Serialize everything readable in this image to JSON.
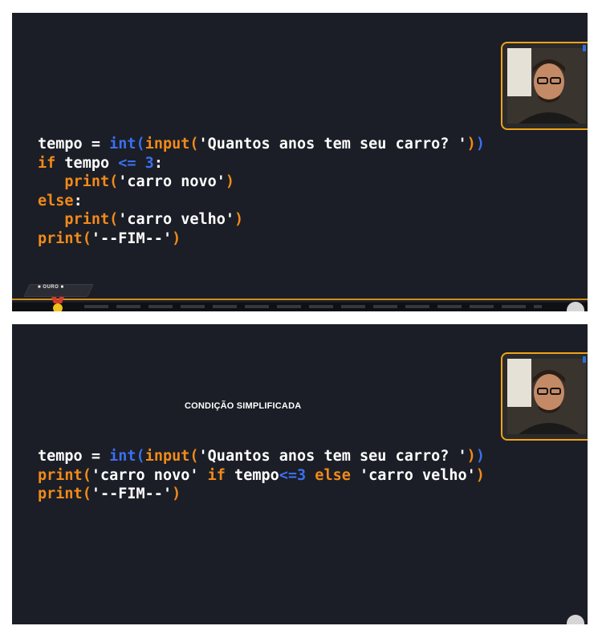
{
  "frame1": {
    "code_lines": [
      [
        {
          "t": "tempo",
          "c": "w"
        },
        {
          "t": " = ",
          "c": "w"
        },
        {
          "t": "int",
          "c": "b"
        },
        {
          "t": "(",
          "c": "b"
        },
        {
          "t": "input",
          "c": "k"
        },
        {
          "t": "(",
          "c": "k"
        },
        {
          "t": "'Quantos anos tem seu carro? '",
          "c": "w"
        },
        {
          "t": ")",
          "c": "k"
        },
        {
          "t": ")",
          "c": "b"
        }
      ],
      [
        {
          "t": "if",
          "c": "k"
        },
        {
          "t": " tempo ",
          "c": "w"
        },
        {
          "t": "<=",
          "c": "b"
        },
        {
          "t": " ",
          "c": "w"
        },
        {
          "t": "3",
          "c": "b"
        },
        {
          "t": ":",
          "c": "w"
        }
      ],
      [
        {
          "t": "   print",
          "c": "k"
        },
        {
          "t": "(",
          "c": "k"
        },
        {
          "t": "'carro novo'",
          "c": "w"
        },
        {
          "t": ")",
          "c": "k"
        }
      ],
      [
        {
          "t": "else",
          "c": "k"
        },
        {
          "t": ":",
          "c": "w"
        }
      ],
      [
        {
          "t": "   print",
          "c": "k"
        },
        {
          "t": "(",
          "c": "k"
        },
        {
          "t": "'carro velho'",
          "c": "w"
        },
        {
          "t": ")",
          "c": "k"
        }
      ],
      [
        {
          "t": "print",
          "c": "k"
        },
        {
          "t": "(",
          "c": "k"
        },
        {
          "t": "'--FIM--'",
          "c": "w"
        },
        {
          "t": ")",
          "c": "k"
        }
      ]
    ],
    "badge": "OURO"
  },
  "frame2": {
    "title": "CONDIÇÃO SIMPLIFICADA",
    "code_lines": [
      [
        {
          "t": "tempo",
          "c": "w"
        },
        {
          "t": " = ",
          "c": "w"
        },
        {
          "t": "int",
          "c": "b"
        },
        {
          "t": "(",
          "c": "b"
        },
        {
          "t": "input",
          "c": "k"
        },
        {
          "t": "(",
          "c": "k"
        },
        {
          "t": "'Quantos anos tem seu carro? '",
          "c": "w"
        },
        {
          "t": ")",
          "c": "k"
        },
        {
          "t": ")",
          "c": "b"
        }
      ],
      [
        {
          "t": "print",
          "c": "k"
        },
        {
          "t": "(",
          "c": "k"
        },
        {
          "t": "'carro novo' ",
          "c": "w"
        },
        {
          "t": "if",
          "c": "k"
        },
        {
          "t": " tempo",
          "c": "w"
        },
        {
          "t": "<=",
          "c": "b"
        },
        {
          "t": "3",
          "c": "b"
        },
        {
          "t": " else ",
          "c": "k"
        },
        {
          "t": "'carro velho'",
          "c": "w"
        },
        {
          "t": ")",
          "c": "k"
        }
      ],
      [
        {
          "t": "print",
          "c": "k"
        },
        {
          "t": "(",
          "c": "k"
        },
        {
          "t": "'--FIM--'",
          "c": "w"
        },
        {
          "t": ")",
          "c": "k"
        }
      ]
    ]
  },
  "colors": {
    "background": "#1b1e26",
    "keyword": "#f28a1a",
    "builtin": "#3b6ff0",
    "text": "#ffffff",
    "accent_border": "#f2a21a"
  },
  "icons": {
    "webcam": "presenter-webcam-icon",
    "medal": "medal-icon",
    "scroll": "scroll-knob-icon"
  }
}
